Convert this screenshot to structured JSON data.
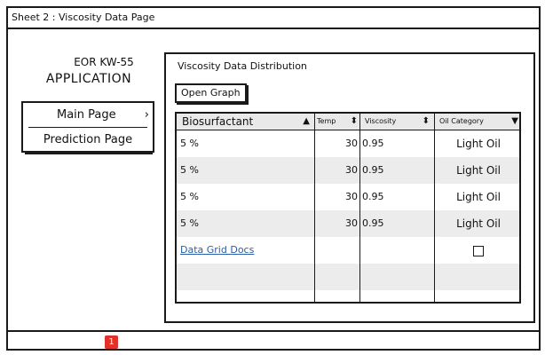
{
  "window": {
    "title": "Sheet 2 :  Viscosity Data Page"
  },
  "app": {
    "name_line1": "EOR KW-55",
    "name_line2": "APPLICATION"
  },
  "nav": {
    "items": [
      {
        "label": "Main Page",
        "icon": "chevron-right-icon",
        "chevron": "›"
      },
      {
        "label": "Prediction Page"
      }
    ]
  },
  "panel": {
    "title": "Viscosity Data Distribution",
    "open_graph_label": "Open Graph"
  },
  "grid": {
    "columns": [
      {
        "label": "Biosurfactant",
        "sort_icon": "▲"
      },
      {
        "label": "Temp",
        "sort_icon": "⬍"
      },
      {
        "label": "Viscosity",
        "sort_icon": "⬍"
      },
      {
        "label": "Oil Category",
        "sort_icon": "▼"
      }
    ],
    "rows": [
      {
        "biosurfactant": "5 %",
        "temp": "30",
        "viscosity": "0.95",
        "oil_category": "Light Oil"
      },
      {
        "biosurfactant": "5 %",
        "temp": "30",
        "viscosity": "0.95",
        "oil_category": "Light Oil"
      },
      {
        "biosurfactant": "5 %",
        "temp": "30",
        "viscosity": "0.95",
        "oil_category": "Light Oil"
      },
      {
        "biosurfactant": "5 %",
        "temp": "30",
        "viscosity": "0.95",
        "oil_category": "Light Oil"
      }
    ],
    "docs_link": "Data Grid Docs",
    "checkbox_checked": false
  },
  "footer": {
    "badge": "1"
  },
  "colors": {
    "badge": "#e0312b",
    "link": "#2b5fa8",
    "row_shade": "#ececec"
  }
}
